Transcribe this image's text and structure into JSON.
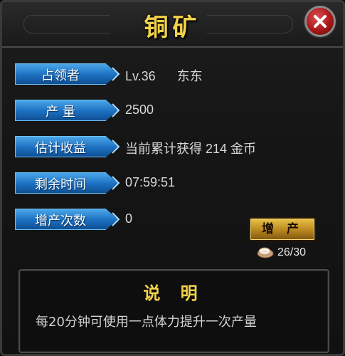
{
  "window": {
    "title": "铜矿",
    "close_icon": "close-icon"
  },
  "rows": {
    "occupant": {
      "label": "占领者",
      "level": "Lv.36",
      "name": "东东"
    },
    "output": {
      "label": "产 量",
      "value": "2500"
    },
    "income": {
      "label": "估计收益",
      "value": "当前累计获得 214 金币"
    },
    "time_left": {
      "label": "剩余时间",
      "value": "07:59:51"
    },
    "boost_count": {
      "label": "增产次数",
      "value": "0"
    }
  },
  "boost": {
    "button_label": "增 产",
    "stamina_icon": "stamina-icon",
    "stamina": "26/30"
  },
  "description": {
    "title": "说 明",
    "text": "每20分钟可使用一点体力提升一次产量"
  },
  "colors": {
    "title": "#f3d34a",
    "label_blue": "#1c6fc0",
    "button_gold": "#d2a536",
    "close_red": "#a81818"
  }
}
